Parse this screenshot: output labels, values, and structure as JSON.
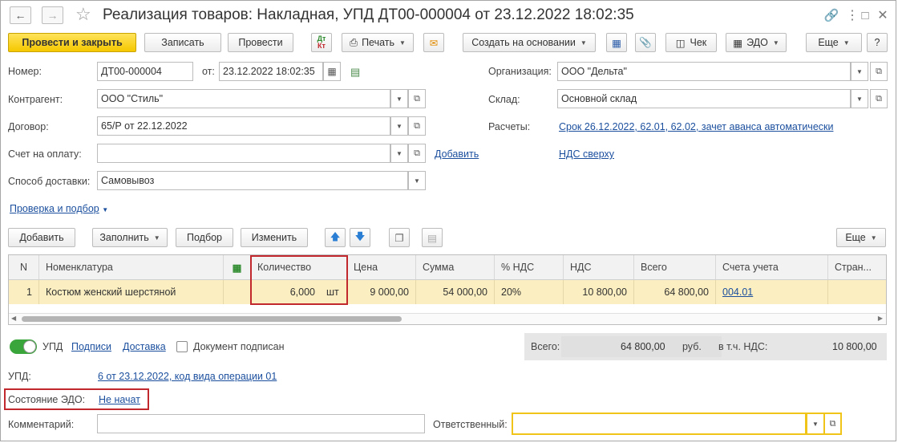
{
  "header": {
    "title": "Реализация товаров: Накладная, УПД ДТ00-000004 от 23.12.2022 18:02:35"
  },
  "toolbar": {
    "post_close": "Провести и закрыть",
    "save": "Записать",
    "post": "Провести",
    "dtkt": "Дт Кт",
    "print": "Печать",
    "create_based": "Создать на основании",
    "check": "Чек",
    "edo": "ЭДО",
    "more": "Еще",
    "help": "?"
  },
  "form": {
    "number_label": "Номер:",
    "number_value": "ДТ00-000004",
    "from_label": "от:",
    "date_value": "23.12.2022 18:02:35",
    "org_label": "Организация:",
    "org_value": "ООО \"Дельта\"",
    "contractor_label": "Контрагент:",
    "contractor_value": "ООО \"Стиль\"",
    "warehouse_label": "Склад:",
    "warehouse_value": "Основной склад",
    "contract_label": "Договор:",
    "contract_value": "65/Р от 22.12.2022",
    "settlements_label": "Расчеты:",
    "settlements_link": "Срок 26.12.2022, 62.01, 62.02, зачет аванса автоматически",
    "invoice_label": "Счет на оплату:",
    "invoice_value": "",
    "add_link": "Добавить",
    "vat_link": "НДС сверху",
    "delivery_label": "Способ доставки:",
    "delivery_value": "Самовывоз",
    "check_select_link": "Проверка и подбор"
  },
  "table_toolbar": {
    "add": "Добавить",
    "fill": "Заполнить",
    "selection": "Подбор",
    "change": "Изменить",
    "more": "Еще"
  },
  "table": {
    "headers": {
      "n": "N",
      "nomenclature": "Номенклатура",
      "quantity": "Количество",
      "price": "Цена",
      "sum": "Сумма",
      "vat_rate": "% НДС",
      "vat": "НДС",
      "total": "Всего",
      "accounts": "Счета учета",
      "country": "Стран..."
    },
    "rows": [
      {
        "n": "1",
        "nomenclature": "Костюм женский шерстяной",
        "quantity": "6,000",
        "unit": "шт",
        "price": "9 000,00",
        "sum": "54 000,00",
        "vat_rate": "20%",
        "vat": "10 800,00",
        "total": "64 800,00",
        "accounts": "004.01"
      }
    ]
  },
  "bottom": {
    "upd_toggle_label": "УПД",
    "signatures_link": "Подписи",
    "delivery_link": "Доставка",
    "signed_label": "Документ подписан",
    "total_label": "Всего:",
    "total_value": "64 800,00",
    "currency": "руб.",
    "vat_incl_label": "в т.ч. НДС:",
    "vat_incl_value": "10 800,00",
    "upd_label": "УПД:",
    "upd_link": "6 от 23.12.2022, код вида операции 01",
    "edo_state_label": "Состояние ЭДО:",
    "edo_state_link": "Не начат",
    "comment_label": "Комментарий:",
    "comment_value": "",
    "responsible_label": "Ответственный:",
    "responsible_value": ""
  },
  "colors": {
    "primary_button": "#f5c800",
    "row_selected": "#fbeec0",
    "link": "#1b4f9e",
    "highlight_box": "#c0282d",
    "toggle_on": "#3aa53a",
    "responsible_border": "#f0c419"
  }
}
